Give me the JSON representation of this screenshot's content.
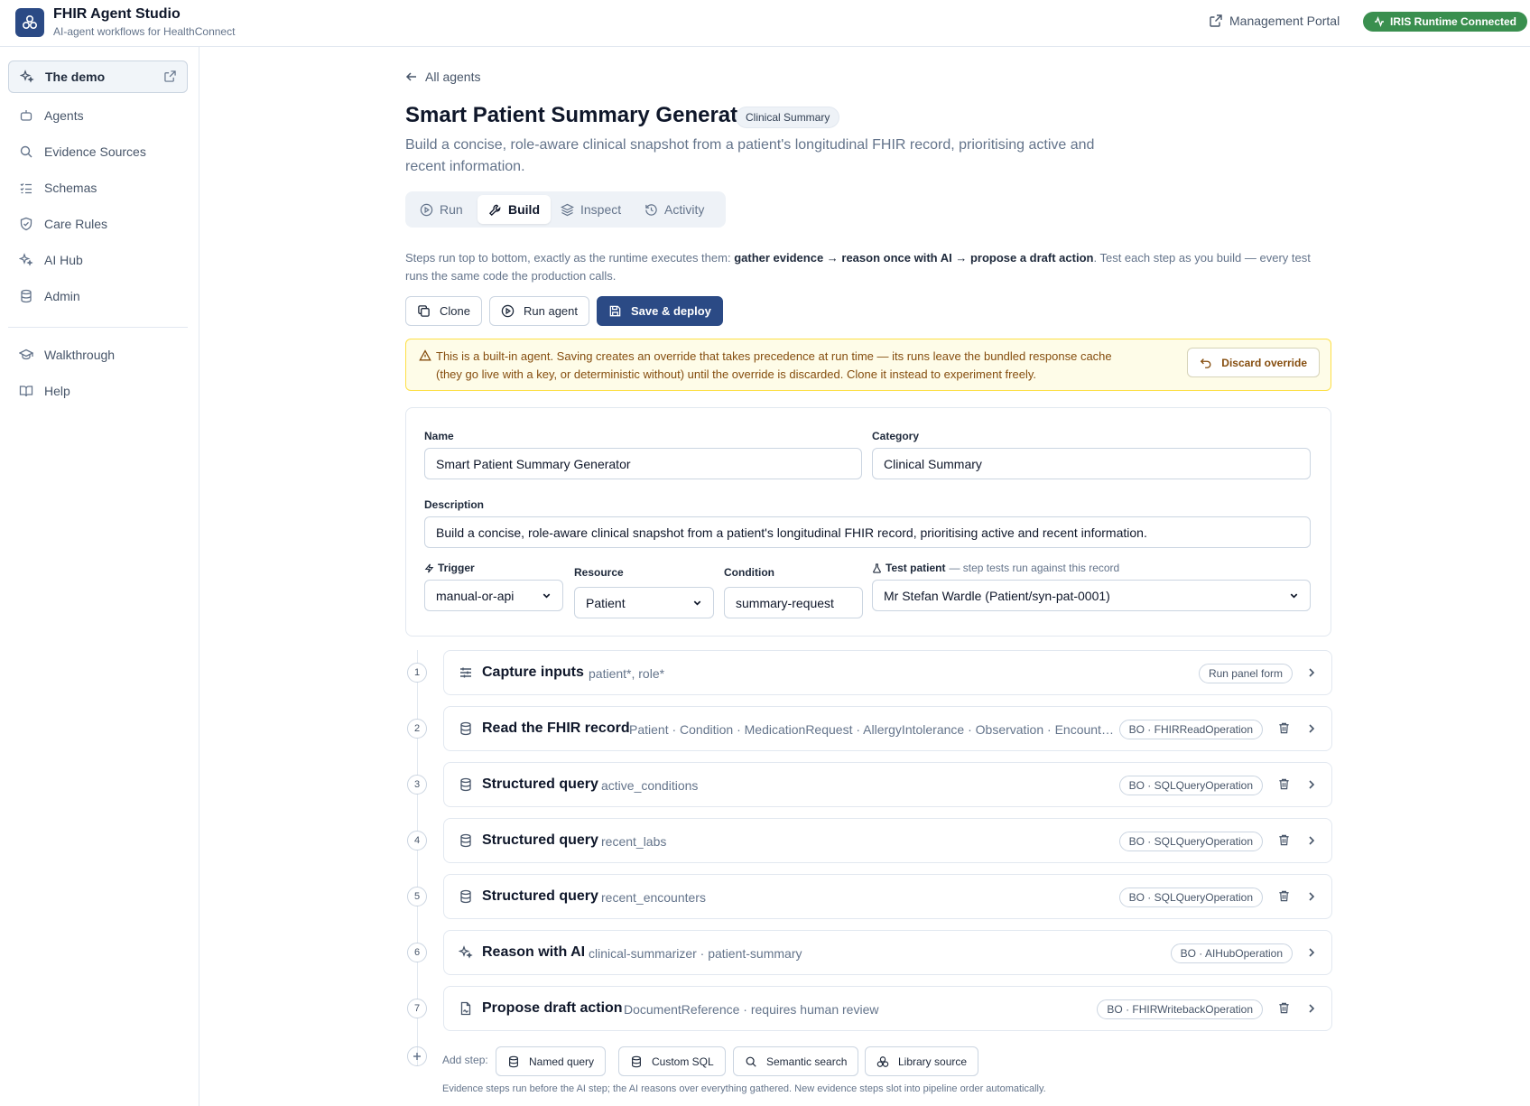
{
  "app": {
    "title": "FHIR Agent Studio",
    "subtitle": "AI-agent workflows for HealthConnect",
    "management_portal": "Management Portal",
    "runtime_status": "IRIS Runtime Connected",
    "runtime_color": "#3a8f4f",
    "brand_color": "#2b4a85"
  },
  "sidebar": {
    "items": [
      {
        "label": "The demo",
        "icon": "sparkles-icon"
      },
      {
        "label": "Agents",
        "icon": "bot-icon"
      },
      {
        "label": "Evidence Sources",
        "icon": "search-icon"
      },
      {
        "label": "Schemas",
        "icon": "list-checks-icon"
      },
      {
        "label": "Care Rules",
        "icon": "shield-icon"
      },
      {
        "label": "AI Hub",
        "icon": "sparkles-icon"
      },
      {
        "label": "Admin",
        "icon": "database-icon"
      },
      {
        "label": "Walkthrough",
        "icon": "graduation-cap-icon"
      },
      {
        "label": "Help",
        "icon": "book-icon"
      }
    ]
  },
  "page": {
    "back": "All agents",
    "title": "Smart Patient Summary Generator",
    "category_badge": "Clinical Summary",
    "description": "Build a concise, role-aware clinical snapshot from a patient's longitudinal FHIR record, prioritising active and recent information.",
    "tabs": [
      {
        "label": "Run",
        "icon": "play-circle-icon"
      },
      {
        "label": "Build",
        "icon": "wrench-icon",
        "active": true
      },
      {
        "label": "Inspect",
        "icon": "layers-icon"
      },
      {
        "label": "Activity",
        "icon": "history-icon"
      }
    ],
    "intro": {
      "prefix": "Steps run top to bottom, exactly as the runtime executes them: ",
      "bold": "gather evidence → reason once with AI → propose a draft action",
      "suffix": ". Test each step as you build — every test runs the same code the production calls."
    },
    "actions": {
      "clone": "Clone",
      "run_agent": "Run agent",
      "save_deploy": "Save & deploy"
    },
    "warning": {
      "text": "This is a built-in agent. Saving creates an override that takes precedence at run time — its runs leave the bundled response cache (they go live with a key, or deterministic without) until the override is discarded. Clone it instead to experiment freely.",
      "discard": "Discard override"
    }
  },
  "form": {
    "name_label": "Name",
    "name_value": "Smart Patient Summary Generator",
    "category_label": "Category",
    "category_value": "Clinical Summary",
    "description_label": "Description",
    "description_value": "Build a concise, role-aware clinical snapshot from a patient's longitudinal FHIR record, prioritising active and recent information.",
    "trigger_label": "Trigger",
    "trigger_value": "manual-or-api",
    "resource_label": "Resource",
    "resource_value": "Patient",
    "condition_label": "Condition",
    "condition_value": "summary-request",
    "test_patient_label": "Test patient",
    "test_patient_hint": "— step tests run against this record",
    "test_patient_value": "Mr Stefan Wardle (Patient/syn-pat-0001)"
  },
  "steps": [
    {
      "num": "1",
      "title": "Capture inputs",
      "detail": "patient*, role*",
      "pill": "Run panel form",
      "icon": "sliders-icon"
    },
    {
      "num": "2",
      "title": "Read the FHIR record",
      "detail": "Patient · Condition · MedicationRequest · AllergyIntolerance · Observation · Encounter…",
      "pill": "BO · FHIRReadOperation",
      "icon": "database-icon"
    },
    {
      "num": "3",
      "title": "Structured query",
      "detail": "active_conditions",
      "pill": "BO · SQLQueryOperation",
      "icon": "database-icon"
    },
    {
      "num": "4",
      "title": "Structured query",
      "detail": "recent_labs",
      "pill": "BO · SQLQueryOperation",
      "icon": "database-icon"
    },
    {
      "num": "5",
      "title": "Structured query",
      "detail": "recent_encounters",
      "pill": "BO · SQLQueryOperation",
      "icon": "database-icon"
    },
    {
      "num": "6",
      "title": "Reason with AI",
      "detail": "clinical-summarizer · patient-summary",
      "pill": "BO · AIHubOperation",
      "icon": "sparkles-icon"
    },
    {
      "num": "7",
      "title": "Propose draft action",
      "detail": "DocumentReference · requires human review",
      "pill": "BO · FHIRWritebackOperation",
      "icon": "file-signature-icon"
    }
  ],
  "add_step": {
    "label": "Add step:",
    "buttons": [
      {
        "label": "Named query",
        "icon": "database-icon"
      },
      {
        "label": "Custom SQL",
        "icon": "database-icon"
      },
      {
        "label": "Semantic search",
        "icon": "search-icon"
      },
      {
        "label": "Library source",
        "icon": "network-icon"
      }
    ],
    "footnote": "Evidence steps run before the AI step; the AI reasons over everything gathered. New evidence steps slot into pipeline order automatically."
  }
}
